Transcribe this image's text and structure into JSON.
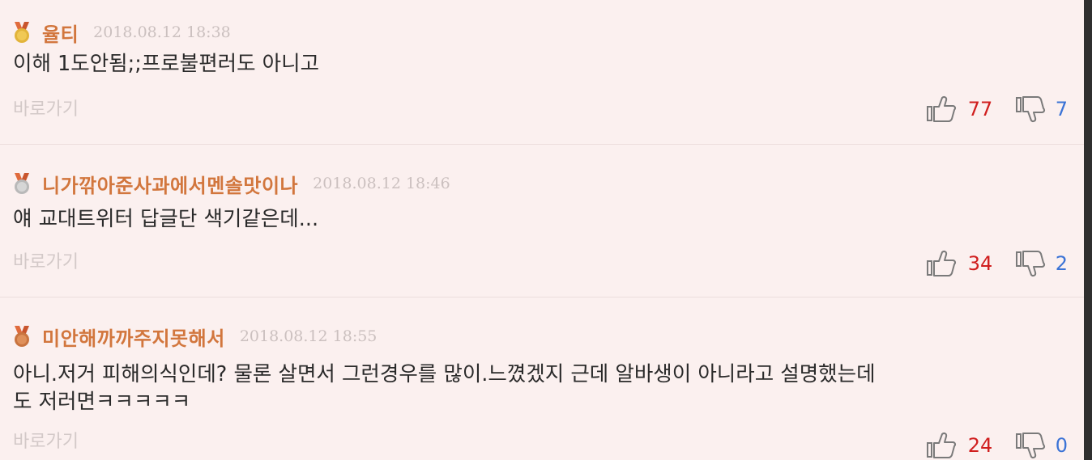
{
  "comments": [
    {
      "medal": "gold-medal",
      "username": "율티",
      "timestamp": "2018.08.12 18:38",
      "text": "이해 1도안됨;;프로불편러도 아니고",
      "goto_label": "바로가기",
      "upvotes": "77",
      "downvotes": "7"
    },
    {
      "medal": "silver-medal",
      "username": "니가깎아준사과에서멘솔맛이나",
      "timestamp": "2018.08.12 18:46",
      "text": "얘 교대트위터 답글단 색기같은데...",
      "goto_label": "바로가기",
      "upvotes": "34",
      "downvotes": "2"
    },
    {
      "medal": "bronze-medal",
      "username": "미안해까까주지못해서",
      "timestamp": "2018.08.12 18:55",
      "text_line1": "아니.저거 피해의식인데? 물론 살면서 그런경우를 많이.느꼈겠지 근데 알바생이 아니라고 설명했는데",
      "text_line2": "도 저러면ㅋㅋㅋㅋㅋ",
      "goto_label": "바로가기",
      "upvotes": "24",
      "downvotes": "0"
    }
  ],
  "colors": {
    "background": "#fbf0ef",
    "username": "#d2763d",
    "upvote": "#d01e1e",
    "downvote": "#3b73d6",
    "gold": "#e2b43a",
    "silver": "#c7c7c7",
    "bronze": "#d3824a"
  }
}
